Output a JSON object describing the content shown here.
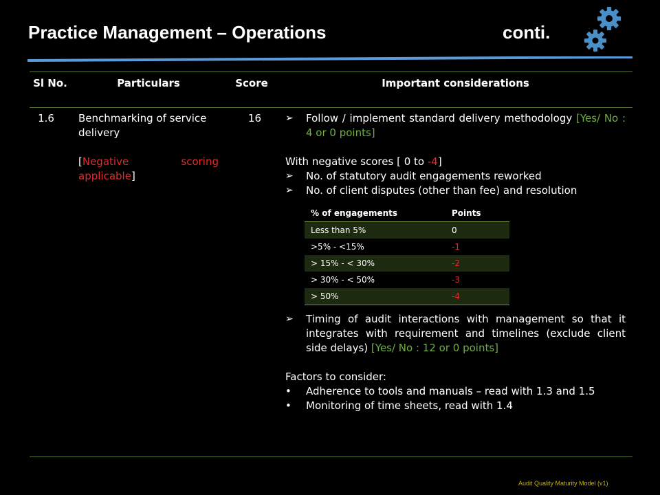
{
  "title": "Practice Management – Operations",
  "title_suffix": "conti.",
  "table": {
    "headers": {
      "sl": "Sl No.",
      "particulars": "Particulars",
      "score": "Score",
      "considerations": "Important considerations"
    },
    "row": {
      "sl": "1.6",
      "particulars": "Benchmarking of service delivery",
      "neg_open": "[",
      "neg_text": "Negative scoring applicable",
      "neg_close": "]",
      "score": "16",
      "c1_text": "Follow / implement standard delivery methodology ",
      "c1_points": "[Yes/ No : 4 or 0 points]",
      "neg_line_pre": "With negative scores [ 0 to ",
      "neg_line_val": "-4",
      "neg_line_post": "]",
      "c2": "No. of statutory audit engagements reworked",
      "c3": "No. of client disputes (other than fee) and resolution",
      "c4_text": "Timing of audit interactions with management so that it integrates with requirement and timelines (exclude client side delays) ",
      "c4_points": "[Yes/ No : 12 or 0 points]",
      "factors_title": "Factors to consider:",
      "f1": "Adherence to tools and manuals – read with 1.3 and 1.5",
      "f2": "Monitoring of time sheets, read with 1.4"
    }
  },
  "points_table": {
    "header": [
      "% of engagements",
      "Points"
    ],
    "rows": [
      [
        "Less than 5%",
        "0"
      ],
      [
        ">5% - <15%",
        "-1"
      ],
      [
        "> 15% - < 30%",
        "-2"
      ],
      [
        "> 30% - < 50%",
        "-3"
      ],
      [
        "> 50%",
        "-4"
      ]
    ]
  },
  "footer": "Audit Quality Maturity Model (v1)",
  "icons": [
    "gear-icon",
    "arrow-bullet-icon",
    "dot-bullet-icon"
  ],
  "colors": {
    "background": "#000000",
    "text": "#ffffff",
    "red": "#e02b2b",
    "green": "#6fae45",
    "rule_blue": "#5b9bd5",
    "gear_blue": "#4a90c8",
    "footer": "#c8b400"
  }
}
